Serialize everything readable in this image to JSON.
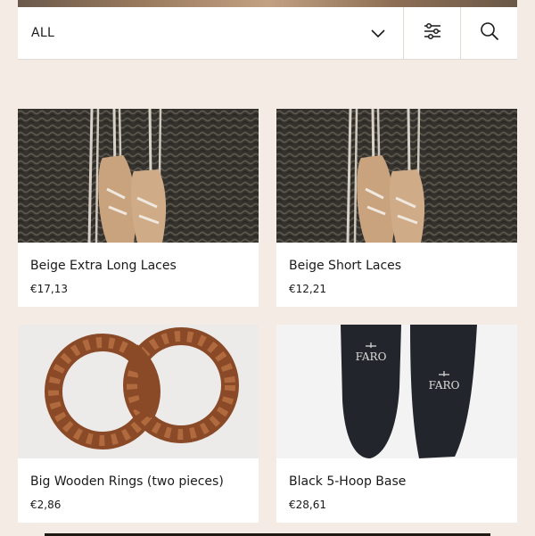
{
  "filter": {
    "selected": "ALL"
  },
  "icons": {
    "dropdown": "chevron-down-icon",
    "filters": "sliders-icon",
    "search": "search-icon"
  },
  "products": [
    {
      "name": "Beige Extra Long Laces",
      "price": "€17,13",
      "image": "laces-on-basket"
    },
    {
      "name": "Beige Short Laces",
      "price": "€12,21",
      "image": "laces-on-basket"
    },
    {
      "name": "Big Wooden Rings (two pieces)",
      "price": "€2,86",
      "image": "wooden-rings"
    },
    {
      "name": "Black 5-Hoop Base",
      "price": "€28,61",
      "image": "black-insoles"
    }
  ],
  "insole_brand": "FARO",
  "colors": {
    "page_background": "#f4ebe5",
    "card_background": "#ffffff",
    "text": "#1a1a1a"
  }
}
